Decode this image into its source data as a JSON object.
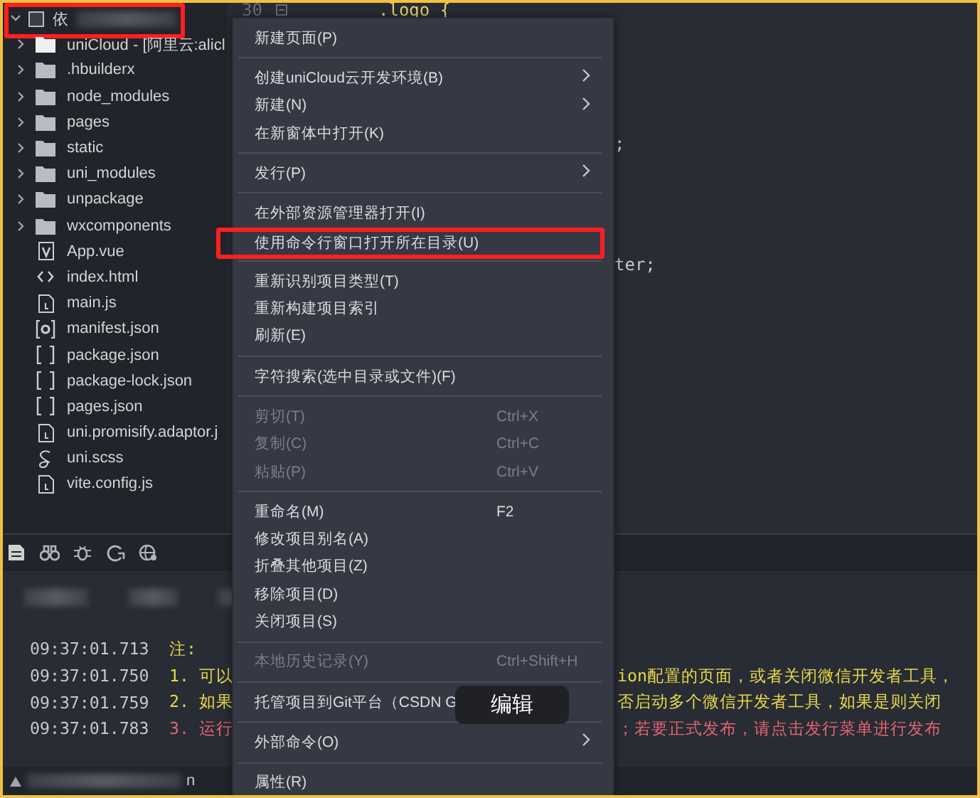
{
  "sidebar": {
    "root": {
      "label": "依",
      "expanded": true,
      "highlighted": true
    },
    "items": [
      {
        "label": "uniCloud - [阿里云:alicl",
        "kind": "cloud",
        "expanded": false
      },
      {
        "label": ".hbuilderx",
        "kind": "folder",
        "expanded": false
      },
      {
        "label": "node_modules",
        "kind": "folder",
        "expanded": false
      },
      {
        "label": "pages",
        "kind": "folder",
        "expanded": false
      },
      {
        "label": "static",
        "kind": "folder",
        "expanded": false
      },
      {
        "label": "uni_modules",
        "kind": "folder",
        "expanded": false
      },
      {
        "label": "unpackage",
        "kind": "folder",
        "expanded": false
      },
      {
        "label": "wxcomponents",
        "kind": "folder",
        "expanded": false
      },
      {
        "label": "App.vue",
        "kind": "vue"
      },
      {
        "label": "index.html",
        "kind": "html"
      },
      {
        "label": "main.js",
        "kind": "script"
      },
      {
        "label": "manifest.json",
        "kind": "manifest"
      },
      {
        "label": "package.json",
        "kind": "json"
      },
      {
        "label": "package-lock.json",
        "kind": "json"
      },
      {
        "label": "pages.json",
        "kind": "json"
      },
      {
        "label": "uni.promisify.adaptor.j",
        "kind": "script"
      },
      {
        "label": "uni.scss",
        "kind": "style"
      },
      {
        "label": "vite.config.js",
        "kind": "script"
      }
    ]
  },
  "editor": {
    "line_number": "30",
    "code": ".logo {",
    "fragments": [
      ";",
      "ter;"
    ]
  },
  "menu": [
    {
      "kind": "item",
      "label": "新建页面(P)",
      "disabled": false,
      "highlighted": false
    },
    {
      "kind": "separator"
    },
    {
      "kind": "submenu",
      "label": "创建uniCloud云开发环境(B)",
      "disabled": false,
      "highlighted": false
    },
    {
      "kind": "submenu",
      "label": "新建(N)",
      "disabled": false,
      "highlighted": false
    },
    {
      "kind": "item",
      "label": "在新窗体中打开(K)",
      "disabled": false,
      "highlighted": false
    },
    {
      "kind": "separator"
    },
    {
      "kind": "submenu",
      "label": "发行(P)",
      "disabled": false,
      "highlighted": false
    },
    {
      "kind": "separator"
    },
    {
      "kind": "item",
      "label": "在外部资源管理器打开(I)",
      "disabled": false,
      "highlighted": false
    },
    {
      "kind": "item",
      "label": "使用命令行窗口打开所在目录(U)",
      "disabled": false,
      "highlighted": true
    },
    {
      "kind": "separator"
    },
    {
      "kind": "item",
      "label": "重新识别项目类型(T)",
      "disabled": false,
      "highlighted": false
    },
    {
      "kind": "item",
      "label": "重新构建项目索引",
      "disabled": false,
      "highlighted": false
    },
    {
      "kind": "item",
      "label": "刷新(E)",
      "disabled": false,
      "highlighted": false
    },
    {
      "kind": "separator"
    },
    {
      "kind": "item",
      "label": "字符搜索(选中目录或文件)(F)",
      "disabled": false,
      "highlighted": false
    },
    {
      "kind": "separator"
    },
    {
      "kind": "item",
      "label": "剪切(T)",
      "shortcut": "Ctrl+X",
      "disabled": true,
      "highlighted": false
    },
    {
      "kind": "item",
      "label": "复制(C)",
      "shortcut": "Ctrl+C",
      "disabled": true,
      "highlighted": false
    },
    {
      "kind": "item",
      "label": "粘贴(P)",
      "shortcut": "Ctrl+V",
      "disabled": true,
      "highlighted": false
    },
    {
      "kind": "separator"
    },
    {
      "kind": "item",
      "label": "重命名(M)",
      "shortcut": "F2",
      "disabled": false,
      "highlighted": false
    },
    {
      "kind": "item",
      "label": "修改项目别名(A)",
      "disabled": false,
      "highlighted": false
    },
    {
      "kind": "item",
      "label": "折叠其他项目(Z)",
      "disabled": false,
      "highlighted": false
    },
    {
      "kind": "item",
      "label": "移除项目(D)",
      "disabled": false,
      "highlighted": false
    },
    {
      "kind": "item",
      "label": "关闭项目(S)",
      "disabled": false,
      "highlighted": false
    },
    {
      "kind": "separator"
    },
    {
      "kind": "item",
      "label": "本地历史记录(Y)",
      "shortcut": "Ctrl+Shift+H",
      "disabled": true,
      "highlighted": false
    },
    {
      "kind": "separator"
    },
    {
      "kind": "item",
      "label": "托管项目到Git平台（CSDN G",
      "disabled": false,
      "highlighted": false
    },
    {
      "kind": "separator"
    },
    {
      "kind": "submenu",
      "label": "外部命令(O)",
      "disabled": false,
      "highlighted": false
    },
    {
      "kind": "separator"
    },
    {
      "kind": "item",
      "label": "属性(R)",
      "disabled": false,
      "highlighted": false
    }
  ],
  "tooltip": {
    "text": "编辑"
  },
  "log": [
    {
      "time": "09:37:01.713",
      "kind": "note",
      "left": "注:"
    },
    {
      "time": "09:37:01.750",
      "kind": "warn",
      "left": "1. 可以",
      "right": "ion配置的页面，或者关闭微信开发者工具，"
    },
    {
      "time": "09:37:01.759",
      "kind": "warn",
      "left": "2. 如果",
      "right": "否启动多个微信开发者工具，如果是则关闭"
    },
    {
      "time": "09:37:01.783",
      "kind": "error",
      "left": "3. 运行",
      "right": "；若要正式发布，请点击发行菜单进行发布"
    }
  ],
  "status_bar": {
    "text": "n"
  }
}
